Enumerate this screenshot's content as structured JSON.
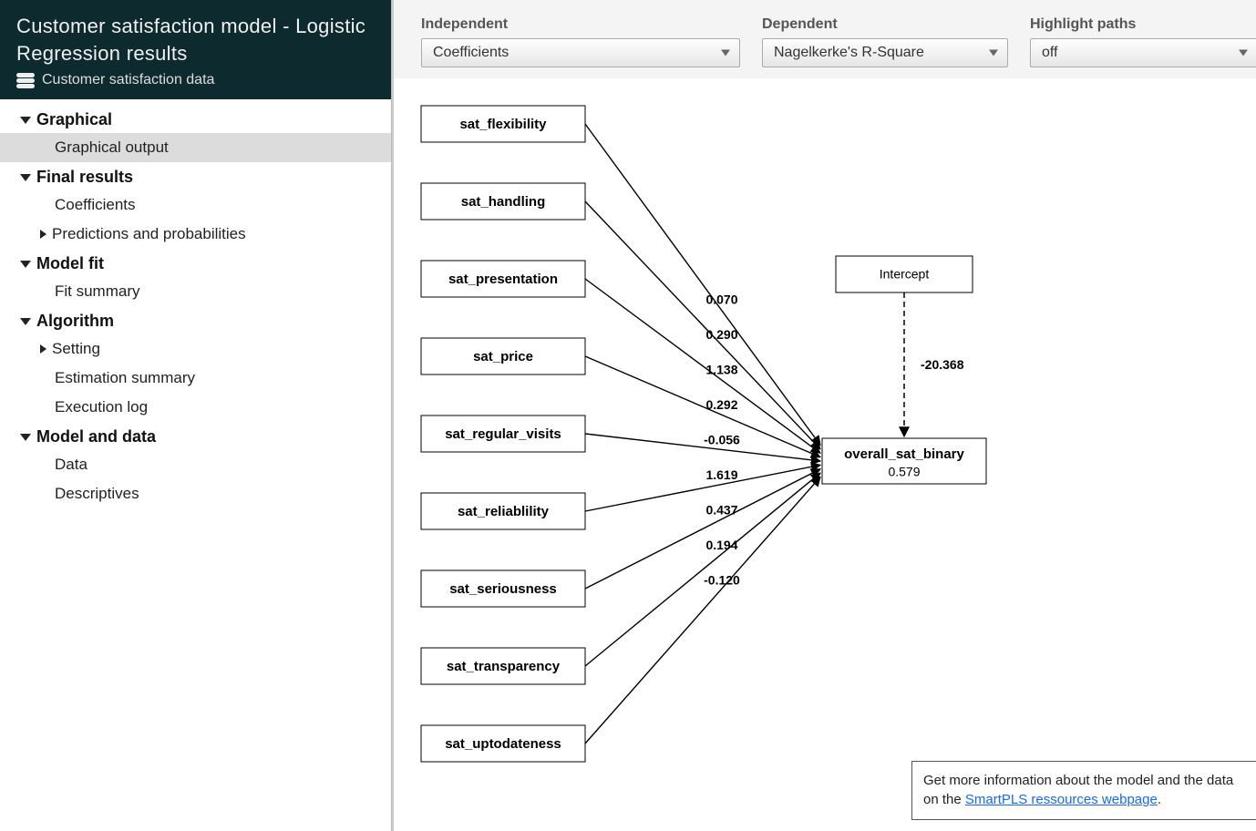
{
  "header": {
    "title": "Customer satisfaction model - Logistic Regression results",
    "dataset": "Customer satisfaction data"
  },
  "nav": {
    "sections": [
      {
        "label": "Graphical",
        "items": [
          {
            "label": "Graphical output",
            "selected": true
          }
        ]
      },
      {
        "label": "Final results",
        "items": [
          {
            "label": "Coefficients"
          },
          {
            "label": "Predictions and probabilities",
            "caret": true
          }
        ]
      },
      {
        "label": "Model fit",
        "items": [
          {
            "label": "Fit summary"
          }
        ]
      },
      {
        "label": "Algorithm",
        "items": [
          {
            "label": "Setting",
            "caret": true
          },
          {
            "label": "Estimation summary"
          },
          {
            "label": "Execution log"
          }
        ]
      },
      {
        "label": "Model and data",
        "items": [
          {
            "label": "Data"
          },
          {
            "label": "Descriptives"
          }
        ]
      }
    ]
  },
  "controls": {
    "independent": {
      "label": "Independent",
      "value": "Coefficients"
    },
    "dependent": {
      "label": "Dependent",
      "value": "Nagelkerke's R-Square"
    },
    "highlight": {
      "label": "Highlight paths",
      "value": "off"
    }
  },
  "diagram": {
    "predictors": [
      {
        "name": "sat_flexibility",
        "coef": "0.070"
      },
      {
        "name": "sat_handling",
        "coef": "0.290"
      },
      {
        "name": "sat_presentation",
        "coef": "1.138"
      },
      {
        "name": "sat_price",
        "coef": "0.292"
      },
      {
        "name": "sat_regular_visits",
        "coef": "-0.056"
      },
      {
        "name": "sat_reliablility",
        "coef": "1.619"
      },
      {
        "name": "sat_seriousness",
        "coef": "0.437"
      },
      {
        "name": "sat_transparency",
        "coef": "0.194"
      },
      {
        "name": "sat_uptodateness",
        "coef": "-0.120"
      }
    ],
    "intercept": {
      "name": "Intercept",
      "value": "-20.368"
    },
    "dependent": {
      "name": "overall_sat_binary",
      "metric": "0.579"
    }
  },
  "info": {
    "text_before": "Get more information about the model and the data on the ",
    "link_text": "SmartPLS ressources webpage",
    "text_after": "."
  }
}
